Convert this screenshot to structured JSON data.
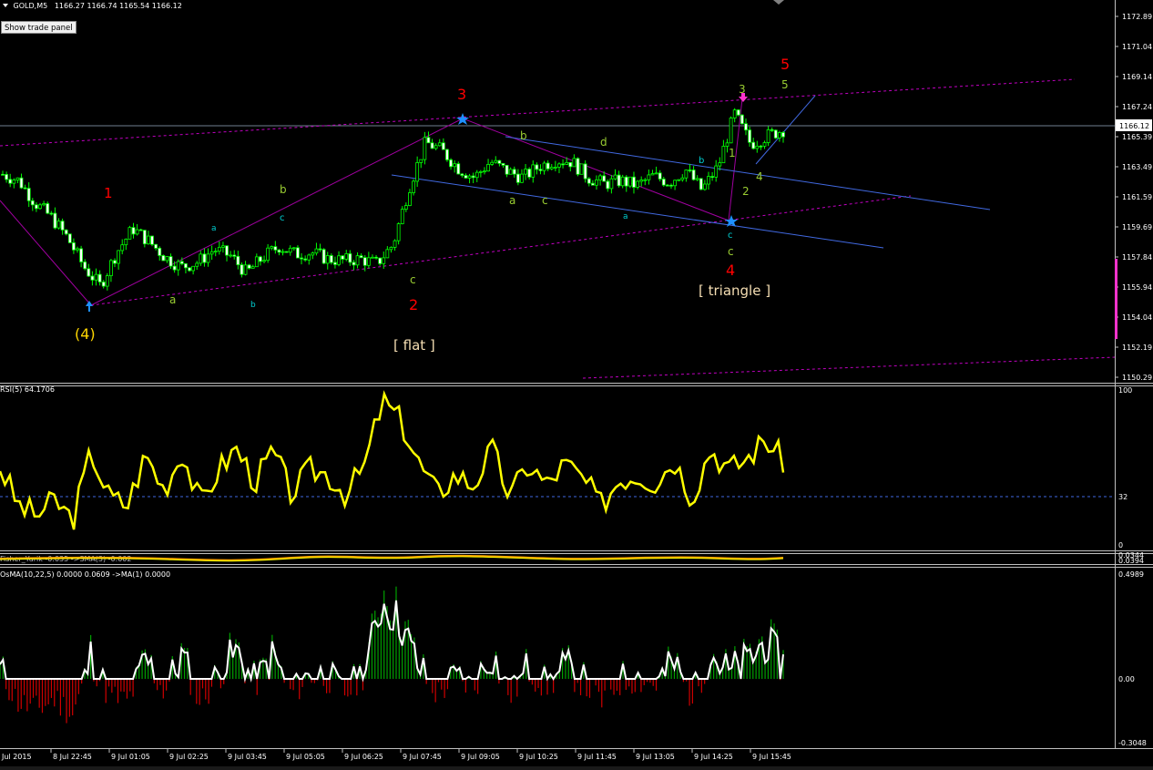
{
  "symbol_header": {
    "symbol": "GOLD,M5",
    "ohlc": "1166.27 1166.74 1165.54 1166.12"
  },
  "trade_panel_button": "Show trade panel",
  "price_axis": {
    "ticks": [
      "1172.89",
      "1171.04",
      "1169.14",
      "1167.24",
      "1165.39",
      "1163.49",
      "1161.59",
      "1159.69",
      "1157.84",
      "1155.94",
      "1154.04",
      "1152.19",
      "1150.29"
    ],
    "current_price": "1166.12"
  },
  "time_axis": {
    "ticks": [
      "Jul 2015",
      "8 Jul 22:45",
      "9 Jul 01:05",
      "9 Jul 02:25",
      "9 Jul 03:45",
      "9 Jul 05:05",
      "9 Jul 06:25",
      "9 Jul 07:45",
      "9 Jul 09:05",
      "9 Jul 10:25",
      "9 Jul 11:45",
      "9 Jul 13:05",
      "9 Jul 14:25",
      "9 Jul 15:45"
    ]
  },
  "wave_labels": {
    "major": [
      "(4)",
      "1",
      "2",
      "3",
      "4",
      "5"
    ],
    "minor": [
      "a",
      "b",
      "c",
      "a",
      "b",
      "c",
      "a",
      "b",
      "c",
      "d",
      "a",
      "b",
      "c",
      "3",
      "5",
      "1",
      "2",
      "4"
    ],
    "patterns": [
      "[ flat ]",
      "[ triangle ]"
    ]
  },
  "rsi_panel": {
    "label": "RSI(5) 64.1706",
    "axis": [
      "100",
      "32",
      "0"
    ]
  },
  "fisher_panel": {
    "label": "Fisher_Yurik -0.035 ->SMA(3) -0.002",
    "axis": [
      "0.0344",
      "0.0394"
    ]
  },
  "osma_panel": {
    "label": "OsMA(10,22,5) 0.0000 0.0609 ->MA(1) 0.0000",
    "axis": [
      "0.4989",
      "0.00",
      "-0.3048"
    ]
  },
  "colors": {
    "bull_candle": "#00ff00",
    "wave_major": "#ff0000",
    "wave_yellow": "#ffd700",
    "wave_minor": "#9acd32",
    "wave_cyan": "#00ced1",
    "channel_magenta": "#c000c0",
    "channel_blue": "#4169e1",
    "rsi_line": "#ffff00",
    "osma_line": "#ffffff",
    "osma_hist_up": "#00a000",
    "osma_hist_down": "#d00000"
  },
  "chart_data": {
    "type": "candlestick",
    "title": "",
    "price_series_approx": [
      1163.0,
      1162.6,
      1161.2,
      1160.3,
      1159.0,
      1157.2,
      1156.0,
      1158.1,
      1159.6,
      1158.8,
      1157.8,
      1157.2,
      1157.5,
      1158.3,
      1157.9,
      1156.8,
      1157.8,
      1158.5,
      1158.0,
      1158.1,
      1157.7,
      1157.6,
      1157.7,
      1157.4,
      1158.6,
      1162.2,
      1165.0,
      1164.5,
      1163.4,
      1162.8,
      1163.8,
      1163.2,
      1162.8,
      1163.5,
      1163.9,
      1163.8,
      1162.8,
      1162.4,
      1162.6,
      1162.3,
      1162.9,
      1162.5,
      1163.3,
      1162.0,
      1163.5,
      1166.8,
      1164.9,
      1165.4,
      1165.8
    ],
    "rsi_series_approx": [
      50,
      25,
      18,
      28,
      15,
      60,
      30,
      25,
      58,
      35,
      60,
      25,
      48,
      62,
      40,
      60,
      32,
      48,
      45,
      32,
      50,
      93,
      80,
      52,
      32,
      45,
      38,
      62,
      30,
      52,
      38,
      52,
      42,
      25,
      42,
      45,
      40,
      55,
      30,
      62,
      48,
      55,
      68,
      54
    ],
    "rsi_axis": [
      0,
      100
    ],
    "rsi_level": 32
  }
}
